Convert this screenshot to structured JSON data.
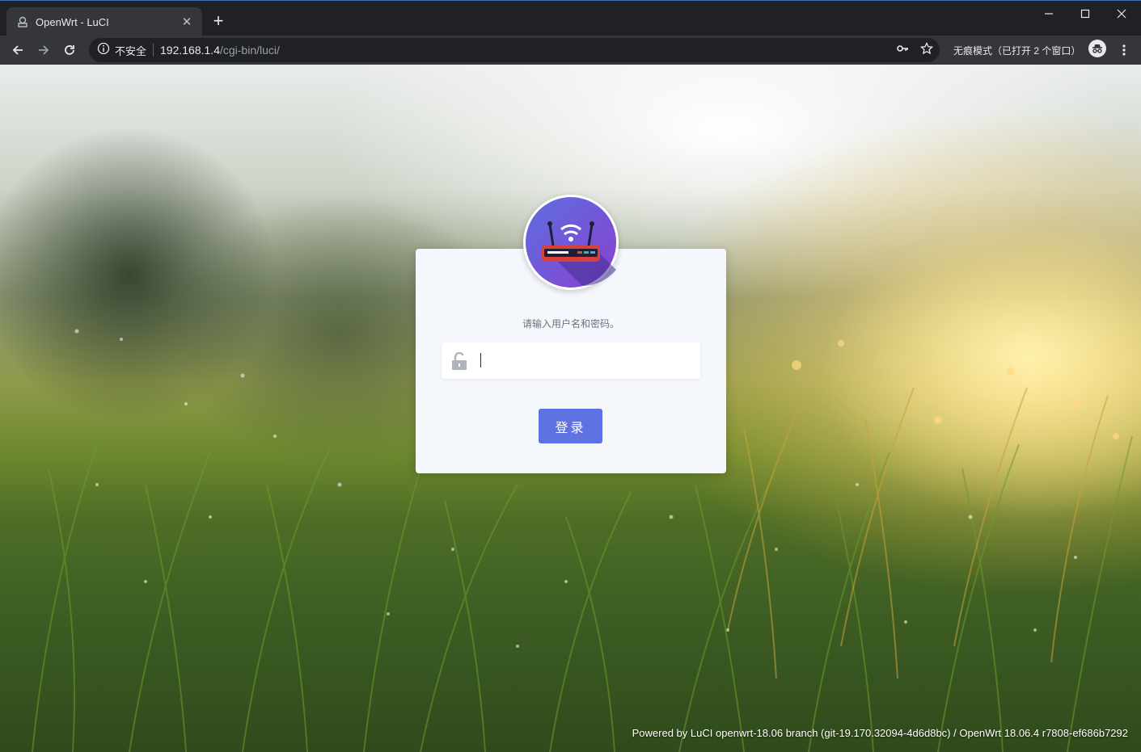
{
  "browser": {
    "tab": {
      "title": "OpenWrt - LuCI",
      "favicon": "openwrt-favicon-icon"
    },
    "new_tab": "+",
    "address": {
      "security_text": "不安全",
      "host": "192.168.1.4",
      "path": "/cgi-bin/luci/"
    },
    "incognito_text": "无痕模式（已打开 2 个窗口）"
  },
  "login": {
    "prompt": "请输入用户名和密码。",
    "password_placeholder": "",
    "submit_label": "登录"
  },
  "footer": {
    "powered_by": "Powered by ",
    "luci_link": "LuCI openwrt-18.06 branch (git-19.170.32094-4d6d8bc)",
    "separator": " / ",
    "firmware": "OpenWrt 18.06.4 r7808-ef686b7292"
  },
  "colors": {
    "accent": "#5e72e4",
    "card_bg": "#f4f7fb",
    "logo_purple": "#6b52d6"
  }
}
